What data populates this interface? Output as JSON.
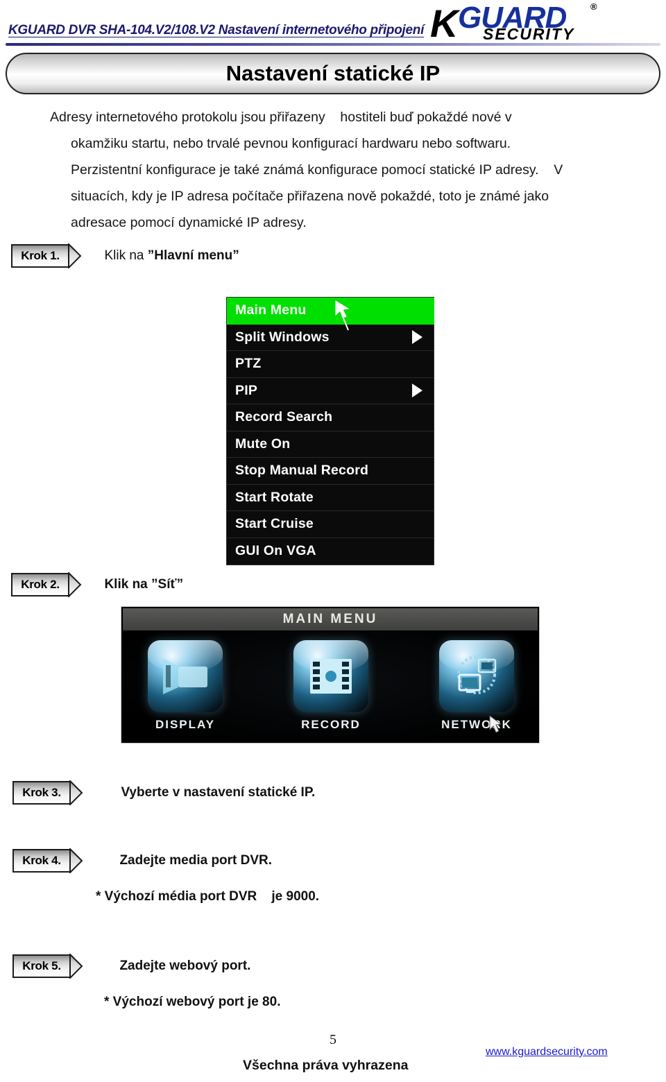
{
  "header": {
    "title": "KGUARD DVR SHA-104.V2/108.V2  Nastavení internetového připojení",
    "logo": {
      "k": "K",
      "guard": "GUARD",
      "security": "SECURITY",
      "registered": "®"
    }
  },
  "banner": {
    "title": "Nastavení statické IP"
  },
  "intro": {
    "line1": "Adresy internetového protokolu jsou přiřazeny    hostiteli buď pokaždé nové v",
    "line2": "okamžiku startu, nebo trvalé pevnou konfigurací hardwaru nebo softwaru.",
    "line3": "Perzistentní konfigurace je také známá konfigurace pomocí statické IP adresy.    V",
    "line4": "situacích, kdy je IP adresa počítače přiřazena nově pokaždé, toto je známé jako",
    "line5": "adresace pomocí dynamické IP adresy."
  },
  "steps": [
    {
      "chip": "Krok 1.",
      "text_prefix": "Klik na ",
      "text_quoted": "”Hlavní menu”"
    },
    {
      "chip": "Krok 2.",
      "text_prefix": "Klik na ",
      "text_quoted": "”Síť”"
    },
    {
      "chip": "Krok 3.",
      "text": "Vyberte v nastavení statické IP."
    },
    {
      "chip": "Krok 4.",
      "text": "Zadejte media port DVR.",
      "note": "* Výchozí média port DVR    je 9000."
    },
    {
      "chip": "Krok 5.",
      "text": "Zadejte webový port.",
      "note": "* Výchozí webový port je 80."
    }
  ],
  "osd_menu": {
    "items": [
      {
        "label": "Main Menu",
        "highlight": true,
        "submenu": false
      },
      {
        "label": "Split Windows",
        "highlight": false,
        "submenu": true
      },
      {
        "label": "PTZ",
        "highlight": false,
        "submenu": false
      },
      {
        "label": "PIP",
        "highlight": false,
        "submenu": true
      },
      {
        "label": "Record Search",
        "highlight": false,
        "submenu": false
      },
      {
        "label": "Mute On",
        "highlight": false,
        "submenu": false
      },
      {
        "label": "Stop Manual Record",
        "highlight": false,
        "submenu": false
      },
      {
        "label": "Start Rotate",
        "highlight": false,
        "submenu": false
      },
      {
        "label": "Start Cruise",
        "highlight": false,
        "submenu": false
      },
      {
        "label": "GUI On VGA",
        "highlight": false,
        "submenu": false
      }
    ],
    "highlight_color": "#00e000",
    "text_color": "#ffffff",
    "background_color": "#0b0b0b"
  },
  "dvr_screenshot": {
    "title": "MAIN MENU",
    "tiles": [
      {
        "label": "DISPLAY",
        "icon": "camera-icon"
      },
      {
        "label": "RECORD",
        "icon": "film-reel-icon"
      },
      {
        "label": "NETWORK",
        "icon": "network-globe-icon"
      }
    ]
  },
  "footer": {
    "page_number": "5",
    "copyright": "Všechna práva vyhrazena",
    "url": "www.kguardsecurity.com"
  }
}
